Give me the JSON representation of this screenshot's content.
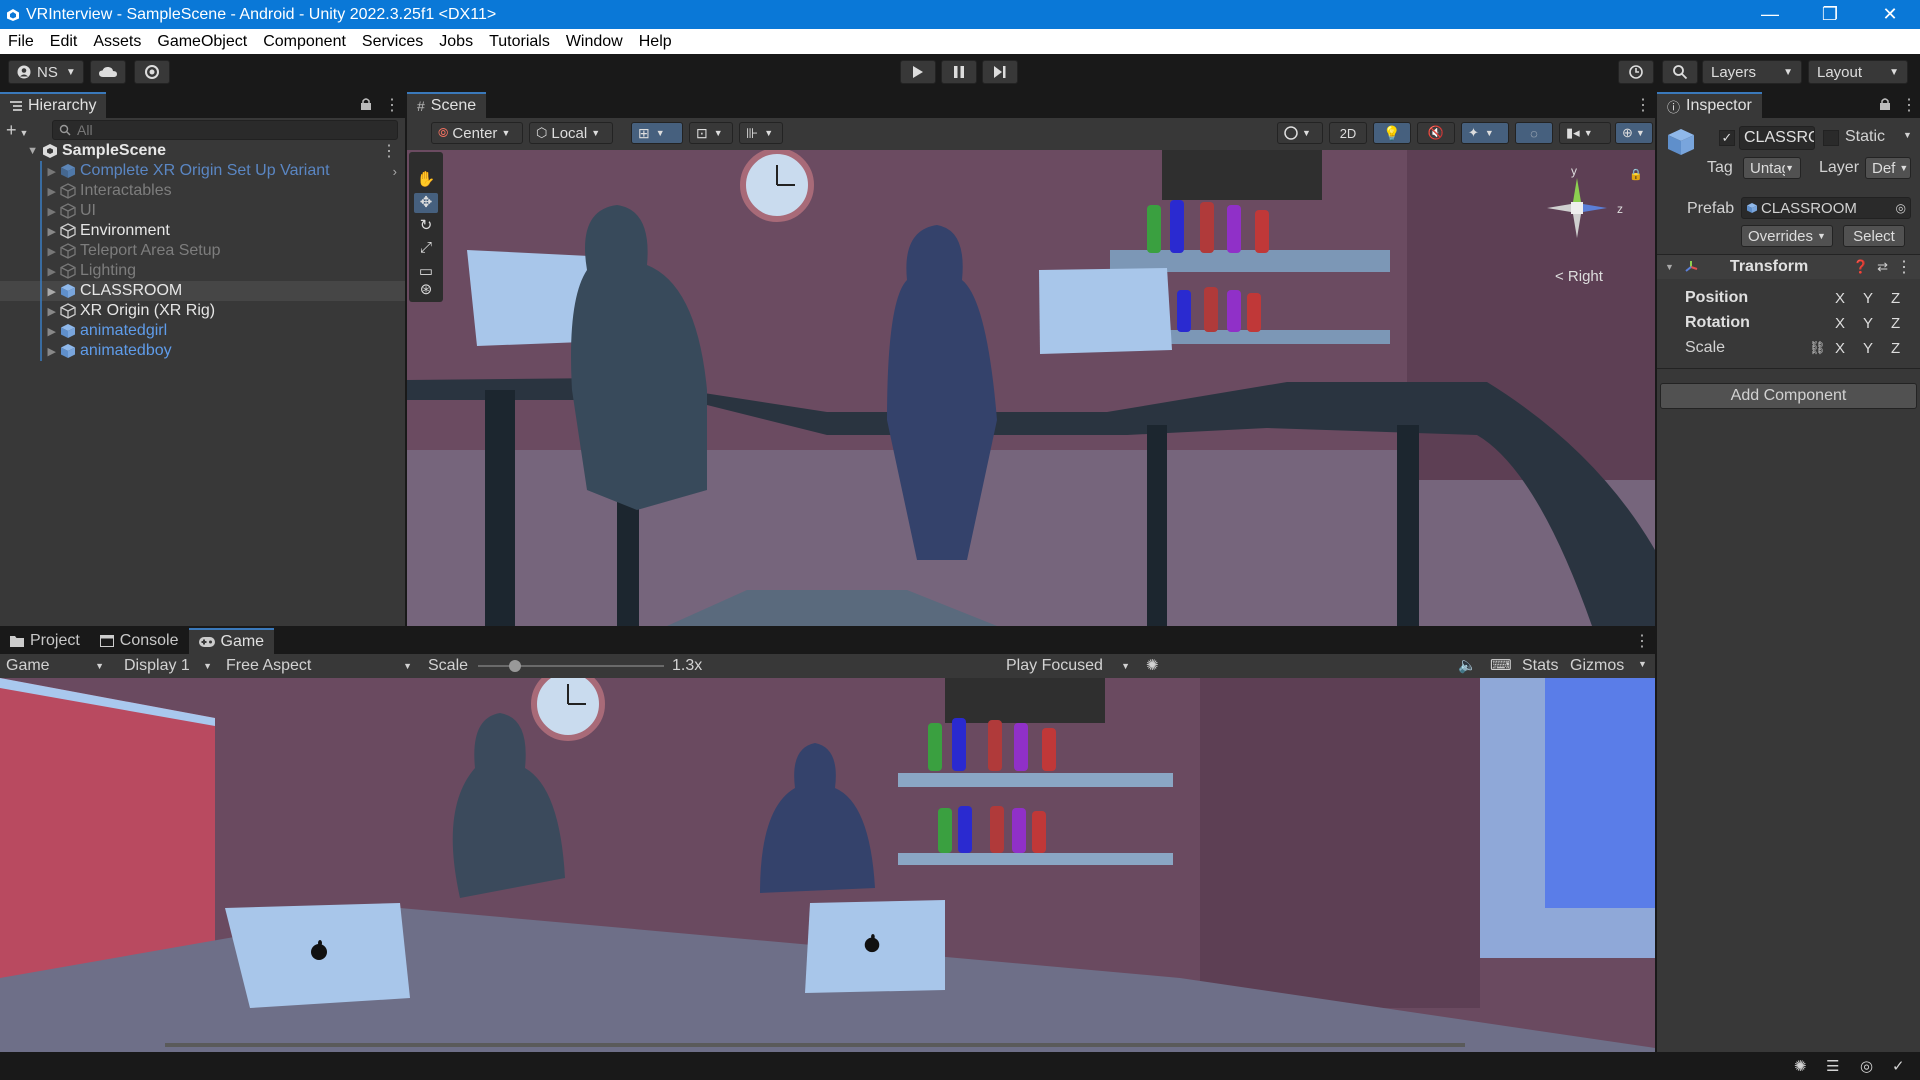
{
  "window": {
    "title": "VRInterview - SampleScene - Android - Unity 2022.3.25f1 <DX11>",
    "minimize": "—",
    "maximize": "❐",
    "close": "✕"
  },
  "menu": [
    "File",
    "Edit",
    "Assets",
    "GameObject",
    "Component",
    "Services",
    "Jobs",
    "Tutorials",
    "Window",
    "Help"
  ],
  "toolbar": {
    "account": "NS",
    "layers": "Layers",
    "layout": "Layout"
  },
  "hierarchy": {
    "tab": "Hierarchy",
    "search_placeholder": "All",
    "scene": "SampleScene",
    "items": [
      {
        "label": "Complete XR Origin Set Up Variant",
        "style": "blue-dim"
      },
      {
        "label": "Interactables",
        "style": "dim"
      },
      {
        "label": "UI",
        "style": "dim"
      },
      {
        "label": "Environment",
        "style": "white"
      },
      {
        "label": "Teleport Area Setup",
        "style": "dim"
      },
      {
        "label": "Lighting",
        "style": "dim"
      },
      {
        "label": "CLASSROOM",
        "style": "white"
      },
      {
        "label": "XR Origin (XR Rig)",
        "style": "white"
      },
      {
        "label": "animatedgirl",
        "style": "blue"
      },
      {
        "label": "animatedboy",
        "style": "blue"
      }
    ]
  },
  "scene": {
    "tab": "Scene",
    "pivot": "Center",
    "space": "Local",
    "mode2d": "2D",
    "gizmo_label": "< Right",
    "gizmo_y": "y",
    "gizmo_z": "z"
  },
  "inspector": {
    "tab": "Inspector",
    "object_name": "CLASSRC",
    "static_label": "Static",
    "tag_label": "Tag",
    "tag_value": "Untag",
    "layer_label": "Layer",
    "layer_value": "Def",
    "prefab_label": "Prefab",
    "prefab_value": "CLASSROOM",
    "overrides": "Overrides",
    "select": "Select",
    "transform_title": "Transform",
    "rows": [
      "Position",
      "Rotation",
      "Scale"
    ],
    "axes": [
      "X",
      "Y",
      "Z"
    ],
    "add_component": "Add Component"
  },
  "bottom": {
    "tabs": [
      "Project",
      "Console",
      "Game"
    ],
    "game_mode": "Game",
    "display": "Display 1",
    "aspect": "Free Aspect",
    "scale_label": "Scale",
    "scale_value": "1.3x",
    "scale_fraction": 0.05,
    "play_focused": "Play Focused",
    "stats": "Stats",
    "gizmos": "Gizmos"
  },
  "colors": {
    "accent": "#0a78d7",
    "selection_blue": "#3a79bb",
    "panel": "#383838",
    "wall": "#6e4a61",
    "laptop": "#a8c6ea"
  }
}
